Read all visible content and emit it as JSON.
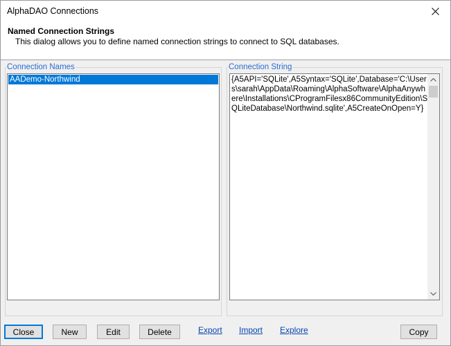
{
  "window": {
    "title": "AlphaDAO Connections"
  },
  "header": {
    "title": "Named Connection Strings",
    "description": "This dialog allows you to define named connection strings to connect to SQL databases."
  },
  "names_panel": {
    "label": "Connection Names",
    "items": [
      {
        "label": "AADemo-Northwind",
        "selected": true
      }
    ]
  },
  "conn_panel": {
    "label": "Connection String",
    "value": "{A5API='SQLite',A5Syntax='SQLite',Database='C:\\Users\\sarah\\AppData\\Roaming\\AlphaSoftware\\AlphaAnywhere\\Installations\\CProgramFilesx86CommunityEdition\\SQLiteDatabase\\Northwind.sqlite',A5CreateOnOpen=Y}"
  },
  "buttons": {
    "close": "Close",
    "new": "New",
    "edit": "Edit",
    "delete": "Delete",
    "copy": "Copy"
  },
  "links": {
    "export": "Export",
    "import": "Import",
    "explore": "Explore"
  },
  "colors": {
    "accent": "#0078d7",
    "group_label": "#2a6bd1",
    "link": "#0645ad"
  }
}
